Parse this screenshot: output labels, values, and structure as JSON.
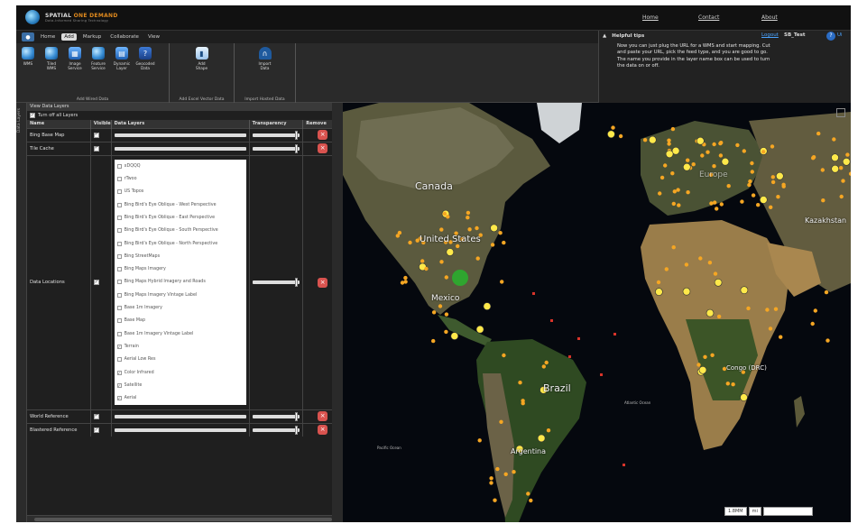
{
  "header": {
    "logo_name": "SPATIAL",
    "logo_accent": "ONE DEMAND",
    "logo_subtitle": "Data-Informed Sharing Technology",
    "nav": [
      "Home",
      "Contact",
      "About"
    ]
  },
  "ribbon": {
    "tabs": [
      "Home",
      "Add",
      "Markup",
      "Collaborate",
      "View"
    ],
    "active_tab": "Add",
    "groups": [
      {
        "label": "Add Wired Data",
        "buttons": [
          "WMS",
          "Tiled WMS",
          "Image Service",
          "Feature Service",
          "Dynamic Layer",
          "Geocoded Data"
        ]
      },
      {
        "label": "Add Excel Vector Data",
        "buttons": [
          "Add Shape"
        ]
      },
      {
        "label": "Import Hosted Data",
        "buttons": [
          "Import Data"
        ]
      }
    ]
  },
  "tips": {
    "title": "Helpful tips",
    "body": "Now you can just plug the URL for a WMS and start mapping. Cut and paste your URL, pick the feed type, and you are good to go. The name you provide in the layer name box can be used to turn the data on or off.",
    "logout": "Logout",
    "user": "SB_Test",
    "help_link": "Ui"
  },
  "layers_panel": {
    "side_tab": "Data Layers",
    "title": "View Data Layers",
    "turn_off_all": "Turn off all Layers",
    "columns": [
      "Name",
      "Visible",
      "Data Layers",
      "Transparency",
      "Remove"
    ],
    "rows": [
      {
        "name": "Bing Base Map",
        "visible": true
      },
      {
        "name": "Tile Cache",
        "visible": true
      },
      {
        "name": "Data Locations",
        "visible": true
      },
      {
        "name": "World Reference",
        "visible": true
      },
      {
        "name": "Blastered Reference",
        "visible": true
      }
    ],
    "sub_layers": [
      {
        "label": "xDQQQ",
        "checked": false
      },
      {
        "label": "rTwoo",
        "checked": false
      },
      {
        "label": "US Topos",
        "checked": false
      },
      {
        "label": "Bing Bird's Eye Oblique - West Perspective",
        "checked": false
      },
      {
        "label": "Bing Bird's Eye Oblique - East Perspective",
        "checked": false
      },
      {
        "label": "Bing Bird's Eye Oblique - South Perspective",
        "checked": false
      },
      {
        "label": "Bing Bird's Eye Oblique - North Perspective",
        "checked": false
      },
      {
        "label": "Bing StreetMaps",
        "checked": false
      },
      {
        "label": "Bing Maps Imagery",
        "checked": false
      },
      {
        "label": "Bing Maps Hybrid Imagery and Roads",
        "checked": false
      },
      {
        "label": "Bing Maps Imagery Vintage Label",
        "checked": false
      },
      {
        "label": "Base 1m Imagery",
        "checked": false
      },
      {
        "label": "Base Map",
        "checked": false
      },
      {
        "label": "Base 1m Imagery Vintage Label",
        "checked": false
      },
      {
        "label": "Terrain",
        "checked": true
      },
      {
        "label": "Aerial Low Res",
        "checked": false
      },
      {
        "label": "Color Infrared",
        "checked": true
      },
      {
        "label": "Satellite",
        "checked": true
      },
      {
        "label": "Aerial",
        "checked": true
      }
    ]
  },
  "map": {
    "labels": [
      "Canada",
      "United States",
      "Mexico",
      "Brazil",
      "Argentina",
      "Kazakhstan",
      "Congo (DRC)",
      "Pacific Ocean",
      "Atlantic Ocean",
      "Europe"
    ],
    "scale": "1.8MM",
    "scale_unit": "mi"
  }
}
